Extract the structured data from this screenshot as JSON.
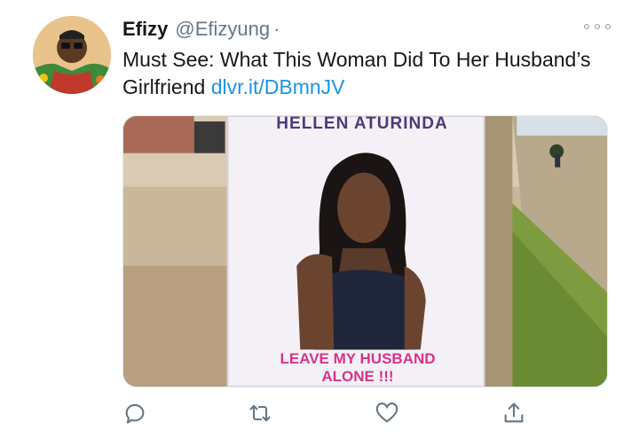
{
  "tweet": {
    "author_name": "Efizy",
    "author_handle": "@Efizyung",
    "separator": "·",
    "text": "Must See: What This Woman Did To Her Husband’s Girlfriend ",
    "link_text": "dlvr.it/DBmnJV"
  },
  "media": {
    "poster_title": "HELLEN ATURINDA",
    "poster_caption_line1": "LEAVE MY HUSBAND",
    "poster_caption_line2": "ALONE !!!"
  },
  "icons": {
    "reply": "comment-icon",
    "retweet": "retweet-icon",
    "like": "heart-icon",
    "share": "share-icon",
    "more": "more-dots-icon"
  },
  "colors": {
    "link": "#1b95e0",
    "icon": "#657786",
    "caption": "#d6348a"
  }
}
